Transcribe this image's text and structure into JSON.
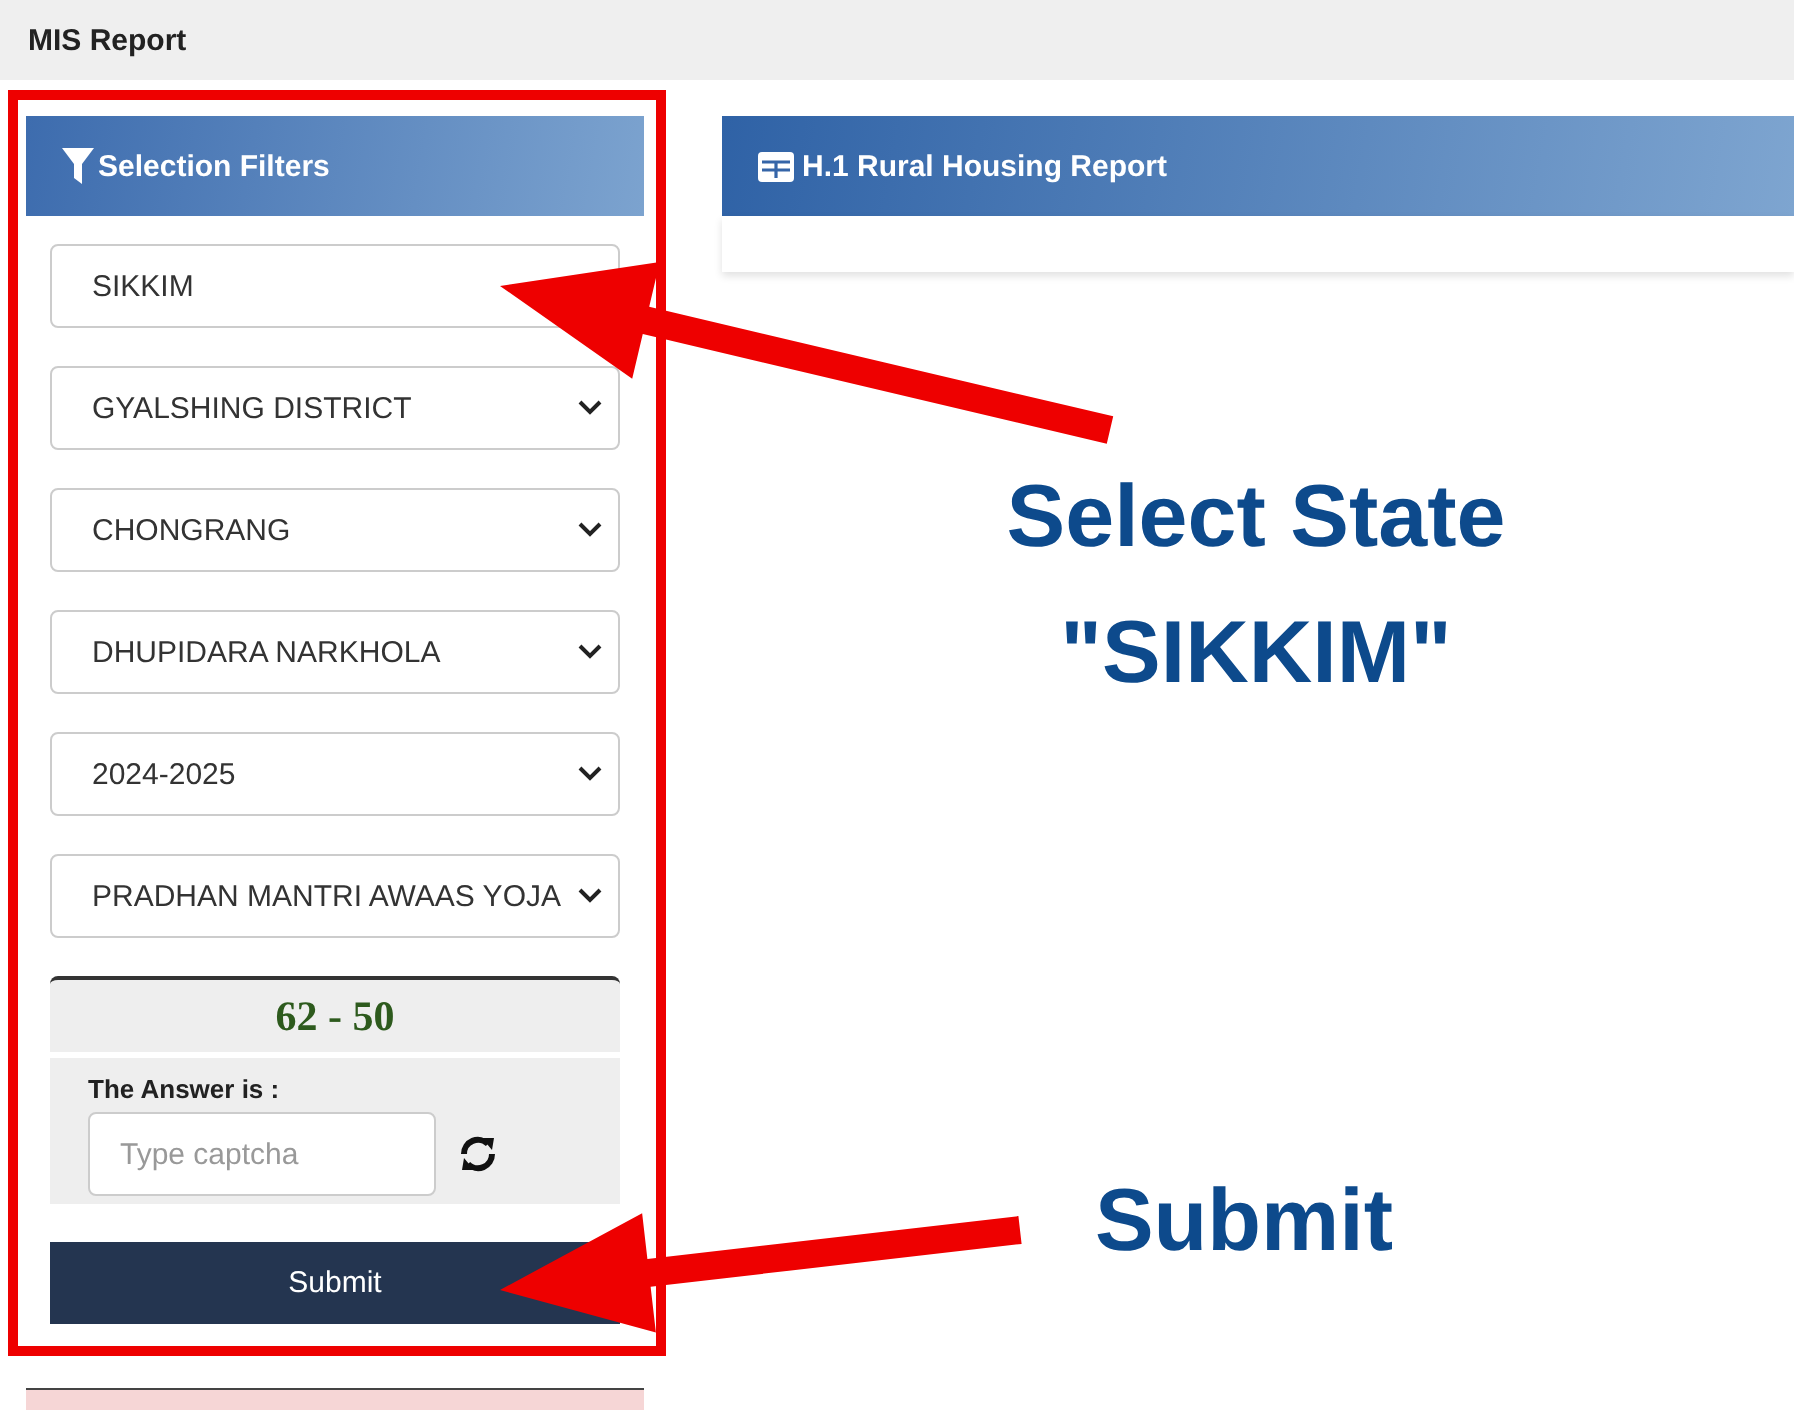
{
  "page_title": "MIS Report",
  "filters": {
    "title": "Selection Filters",
    "fields": [
      {
        "kind": "text",
        "value": "SIKKIM"
      },
      {
        "kind": "select",
        "value": "GYALSHING DISTRICT"
      },
      {
        "kind": "select",
        "value": "CHONGRANG"
      },
      {
        "kind": "select",
        "value": "DHUPIDARA NARKHOLA"
      },
      {
        "kind": "select",
        "value": "2024-2025"
      },
      {
        "kind": "select",
        "value": "PRADHAN MANTRI AWAAS YOJA"
      }
    ],
    "captcha": {
      "question": "62 - 50",
      "label": "The Answer is :",
      "placeholder": "Type captcha"
    },
    "submit": "Submit"
  },
  "report": {
    "title": "H.1 Rural Housing Report"
  },
  "annotations": [
    {
      "text": "Select State"
    },
    {
      "text": "\"SIKKIM\""
    },
    {
      "text": "Submit"
    }
  ]
}
